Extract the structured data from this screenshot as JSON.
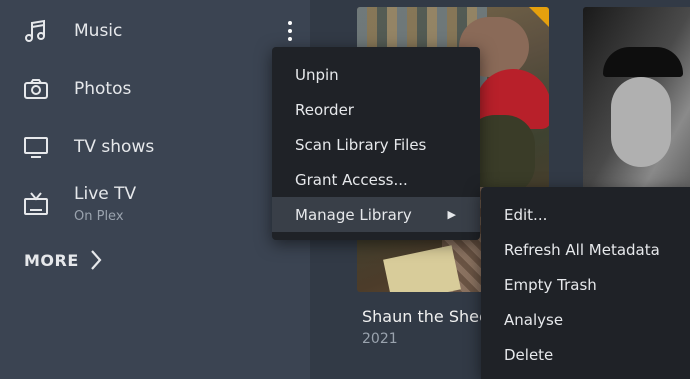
{
  "sidebar": {
    "items": [
      {
        "label": "Music",
        "icon": "music-note-icon"
      },
      {
        "label": "Photos",
        "icon": "camera-icon"
      },
      {
        "label": "TV shows",
        "icon": "monitor-icon"
      },
      {
        "label": "Live TV",
        "sublabel": "On Plex",
        "icon": "tv-antenna-icon"
      }
    ],
    "more_label": "MORE"
  },
  "context_menu": {
    "items": [
      "Unpin",
      "Reorder",
      "Scan Library Files",
      "Grant Access...",
      "Manage Library"
    ],
    "submenu_arrow": "▶"
  },
  "submenu": {
    "items": [
      "Edit...",
      "Refresh All Metadata",
      "Empty Trash",
      "Analyse",
      "Delete"
    ]
  },
  "media": [
    {
      "title": "Shaun the Sheep",
      "year": "2021"
    }
  ],
  "colors": {
    "accent": "#e5a00d",
    "menu_bg": "#1f2227",
    "sidebar_bg": "#3b4452",
    "main_bg": "#323a46"
  }
}
